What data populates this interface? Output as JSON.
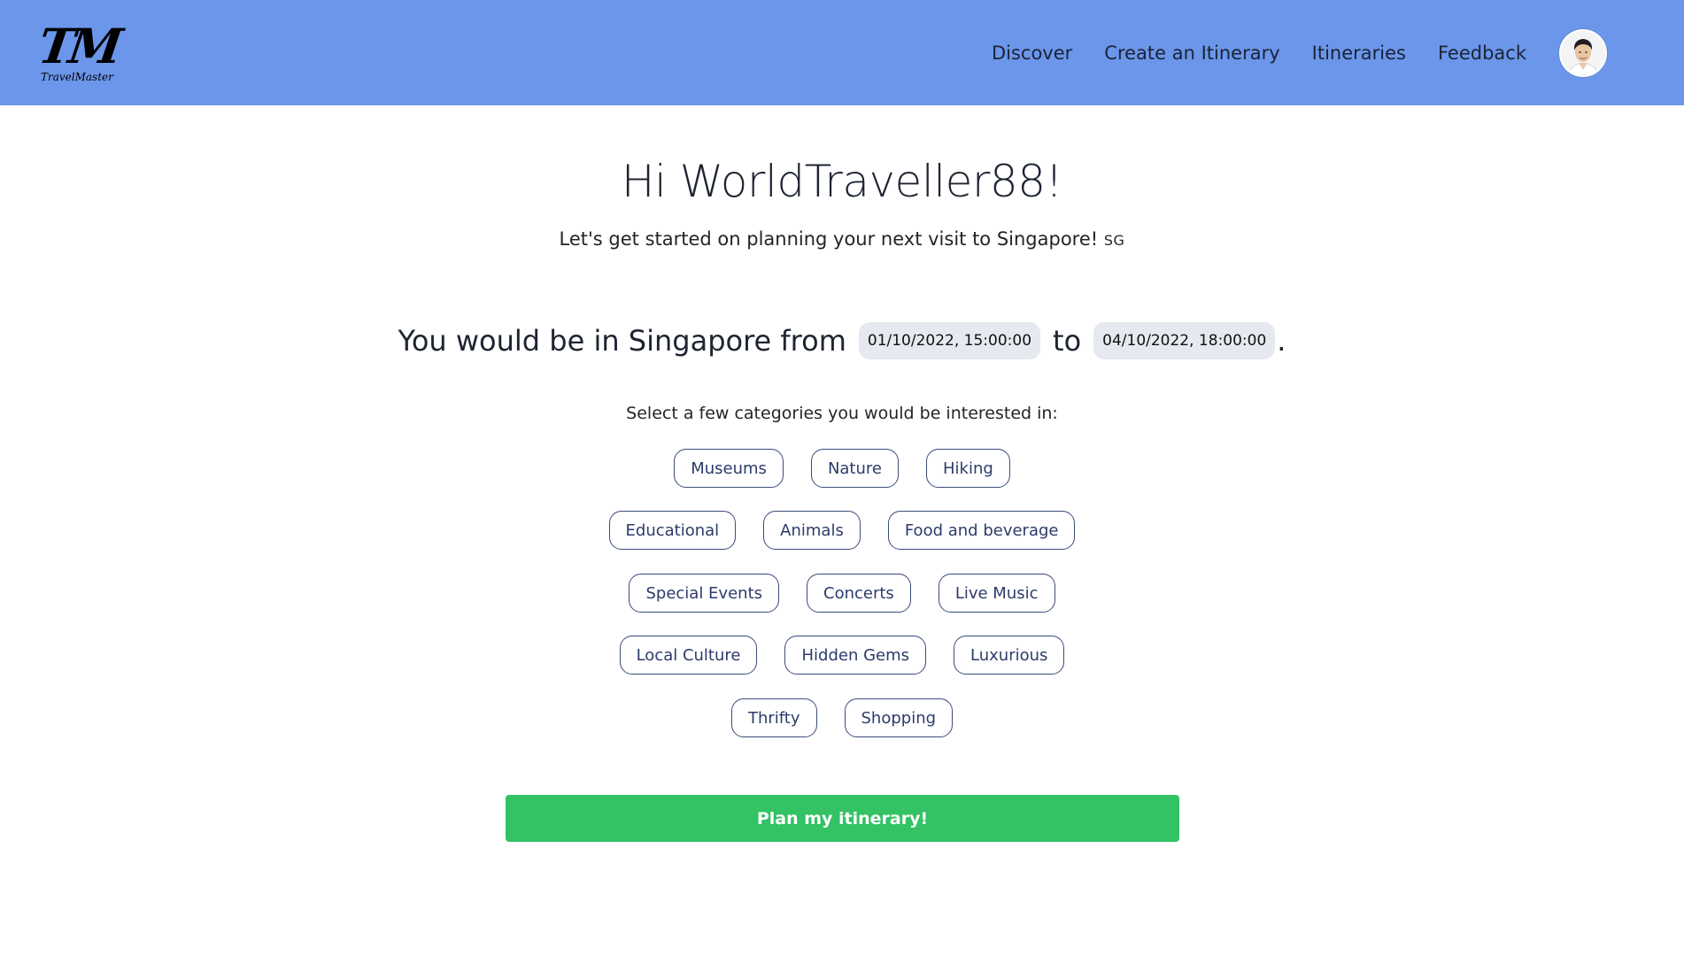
{
  "brand": {
    "logo_mark": "TM",
    "logo_text": "TravelMaster"
  },
  "nav": {
    "links": [
      "Discover",
      "Create an Itinerary",
      "Itineraries",
      "Feedback"
    ]
  },
  "greeting": "Hi WorldTraveller88!",
  "subtitle": {
    "text": "Let's get started on planning your next visit to Singapore!",
    "flag": "SG"
  },
  "stay": {
    "prefix": "You would be in Singapore from",
    "start": "01/10/2022, 15:00:00",
    "connector": "to",
    "end": "04/10/2022, 18:00:00",
    "suffix": "."
  },
  "categories_prompt": "Select a few categories you would be interested in:",
  "categories": [
    [
      "Museums",
      "Nature",
      "Hiking"
    ],
    [
      "Educational",
      "Animals",
      "Food and beverage"
    ],
    [
      "Special Events",
      "Concerts",
      "Live Music"
    ],
    [
      "Local Culture",
      "Hidden Gems",
      "Luxurious"
    ],
    [
      "Thrifty",
      "Shopping"
    ]
  ],
  "plan_button": "Plan my itinerary!",
  "colors": {
    "navbar": "#6b96ea",
    "pill_border": "#3c4b7b",
    "primary_button": "#33c264"
  }
}
